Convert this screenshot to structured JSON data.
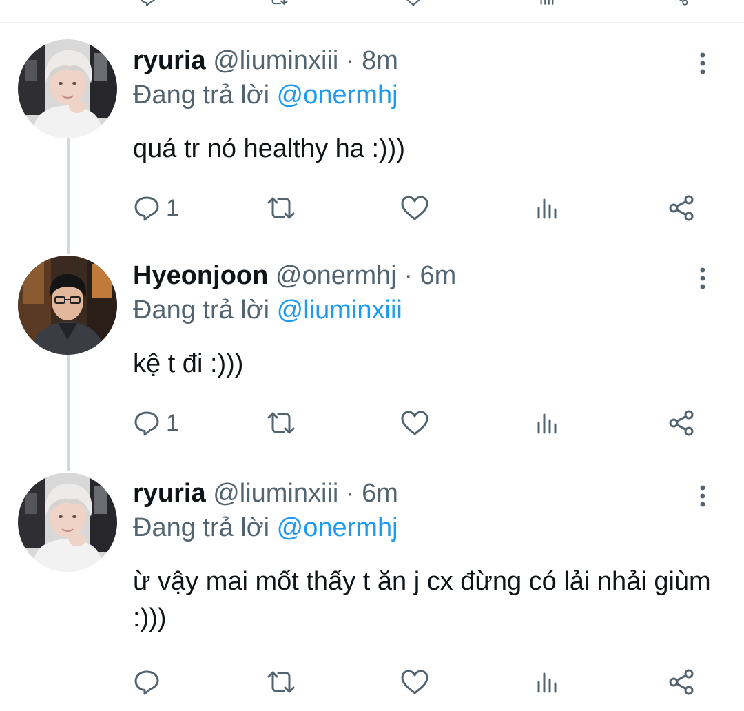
{
  "colors": {
    "accent": "#1d9bf0",
    "text": "#0f1419",
    "secondary": "#536471",
    "thread_line": "#cfd9de",
    "icon": "#536471"
  },
  "icons": {
    "reply": "reply-icon",
    "retweet": "retweet-icon",
    "like": "heart-icon",
    "analytics": "analytics-icon",
    "share": "share-icon",
    "more": "more-vertical-icon"
  },
  "tweets": [
    {
      "name": "ryuria",
      "handle": "@liuminxiii",
      "dot": "·",
      "time": "8m",
      "reply_prefix": "Đang trả lời ",
      "reply_to": "@onermhj",
      "text": "quá tr nó healthy ha :)))",
      "reply_count": "1"
    },
    {
      "name": "Hyeonjoon",
      "handle": "@onermhj",
      "dot": "·",
      "time": "6m",
      "reply_prefix": "Đang trả lời ",
      "reply_to": "@liuminxiii",
      "text": "kệ t đi :)))",
      "reply_count": "1"
    },
    {
      "name": "ryuria",
      "handle": "@liuminxiii",
      "dot": "·",
      "time": "6m",
      "reply_prefix": "Đang trả lời ",
      "reply_to": "@onermhj",
      "text": "ừ vậy mai mốt thấy t ăn j cx đừng có lải nhải giùm :)))",
      "reply_count": ""
    }
  ]
}
